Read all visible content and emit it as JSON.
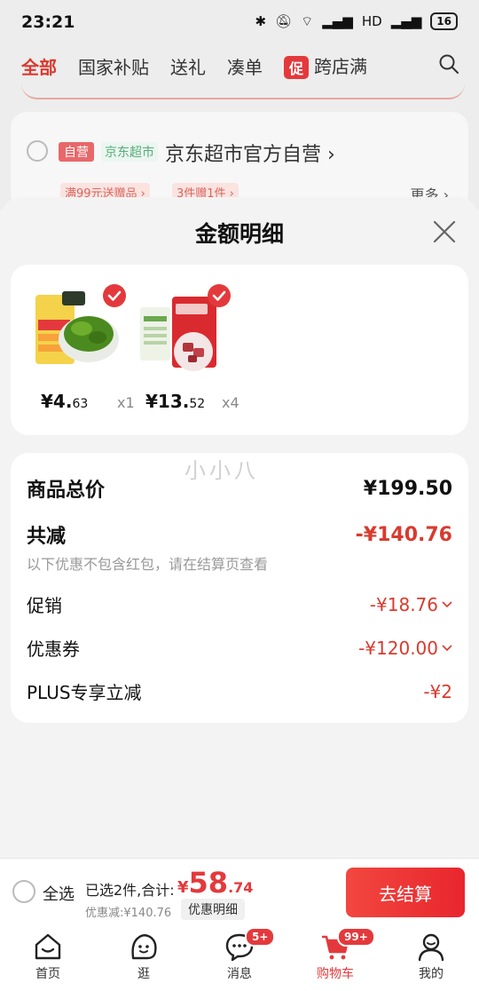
{
  "status_bar": {
    "time": "23:21",
    "battery": "16"
  },
  "top_tabs": {
    "items": [
      "全部",
      "国家补贴",
      "送礼",
      "凑单"
    ],
    "promo_badge": "促",
    "promo_label": "跨店满"
  },
  "background_store": {
    "tag_self": "自营",
    "tag_jd": "京东超市",
    "name": "京东超市官方自营",
    "promo1": "满99元送赠品",
    "promo2": "3件赠1件",
    "more": "更多"
  },
  "sheet": {
    "title": "金额明细",
    "products": [
      {
        "price_int": "¥4.",
        "price_dec": "63",
        "qty": "x1"
      },
      {
        "price_int": "¥13.",
        "price_dec": "52",
        "qty": "x4"
      }
    ],
    "watermark": "小小八",
    "detail": {
      "total_label": "商品总价",
      "total_value": "¥199.50",
      "reduce_label": "共减",
      "reduce_value": "-¥140.76",
      "reduce_note": "以下优惠不包含红包，请在结算页查看",
      "promo_label": "促销",
      "promo_value": "-¥18.76",
      "coupon_label": "优惠券",
      "coupon_value": "-¥120.00",
      "plus_label": "PLUS专享立减",
      "plus_value": "-¥2"
    }
  },
  "checkout": {
    "select_all": "全选",
    "selected_summary": "已选2件,合计:",
    "total_yen": "¥",
    "total_int": "58",
    "total_dec": ".74",
    "discount_line": "优惠减:¥140.76",
    "detail_pill": "优惠明细",
    "button": "去结算"
  },
  "bottom_nav": {
    "items": [
      {
        "label": "首页",
        "icon": "home-icon"
      },
      {
        "label": "逛",
        "icon": "explore-icon"
      },
      {
        "label": "消息",
        "icon": "message-icon",
        "badge": "5+"
      },
      {
        "label": "购物车",
        "icon": "cart-icon",
        "badge": "99+"
      },
      {
        "label": "我的",
        "icon": "profile-icon"
      }
    ]
  },
  "colors": {
    "accent": "#e4393c",
    "green": "#2d9b5a"
  }
}
